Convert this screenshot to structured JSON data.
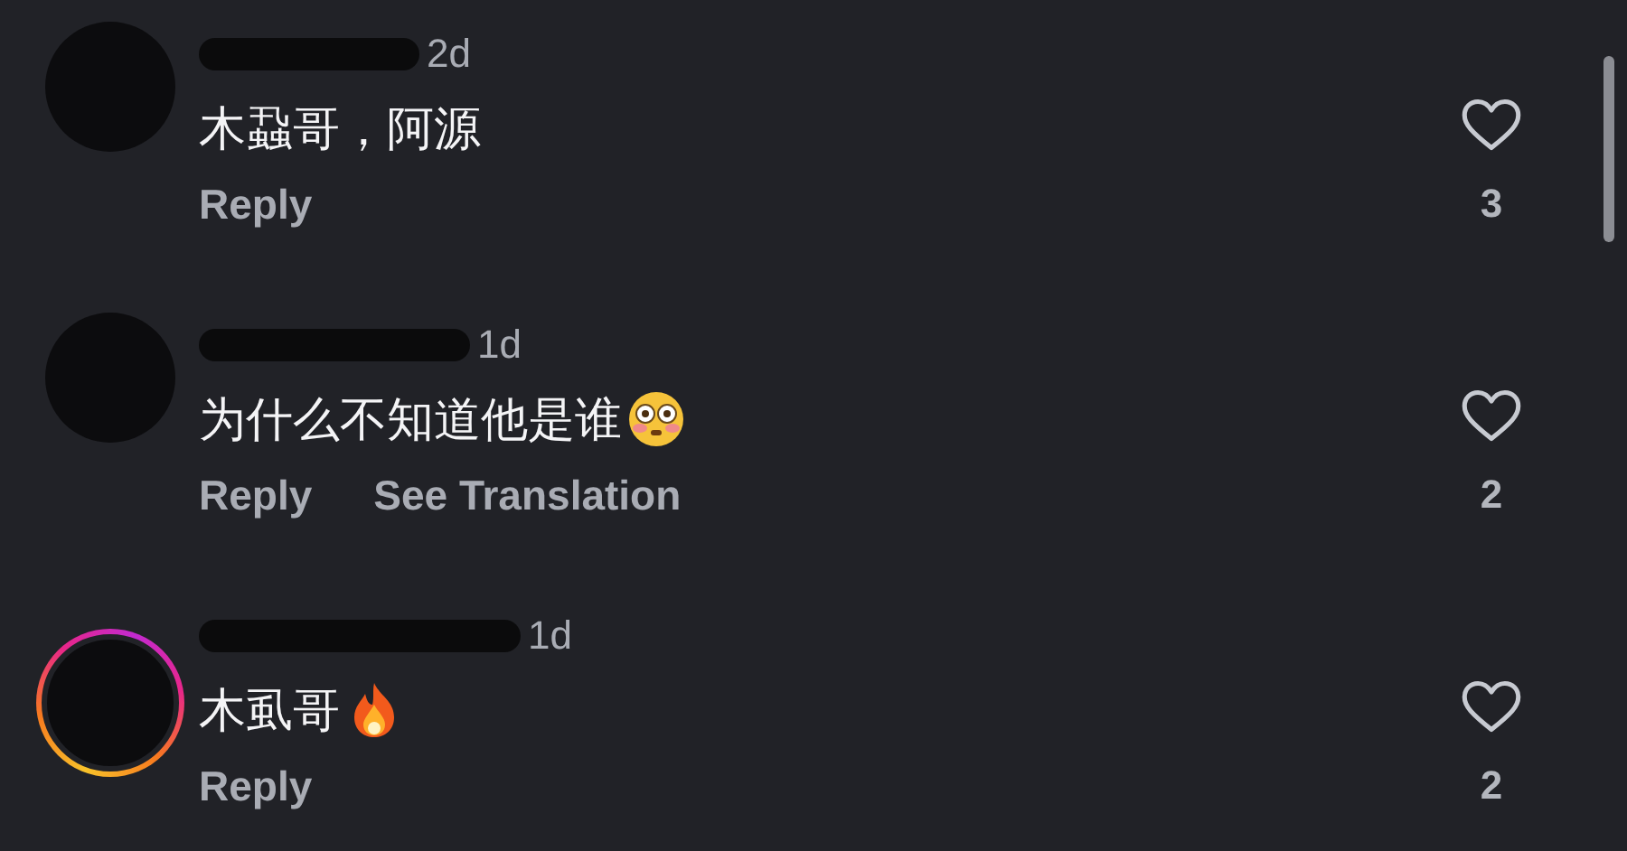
{
  "comments": [
    {
      "username_redacted": true,
      "story_ring": false,
      "time": "2d",
      "text": "木蝨哥，阿源",
      "actions": [
        "Reply"
      ],
      "liked": false,
      "likes": "3"
    },
    {
      "username_redacted": true,
      "story_ring": false,
      "time": "1d",
      "text": "为什么不知道他是谁",
      "emoji": {
        "kind": "flushed"
      },
      "actions": [
        "Reply",
        "See Translation"
      ],
      "liked": false,
      "likes": "2"
    },
    {
      "username_redacted": true,
      "story_ring": true,
      "time": "1d",
      "text": "木虱哥",
      "emoji": {
        "kind": "fire"
      },
      "actions": [
        "Reply"
      ],
      "liked": false,
      "likes": "2"
    }
  ]
}
